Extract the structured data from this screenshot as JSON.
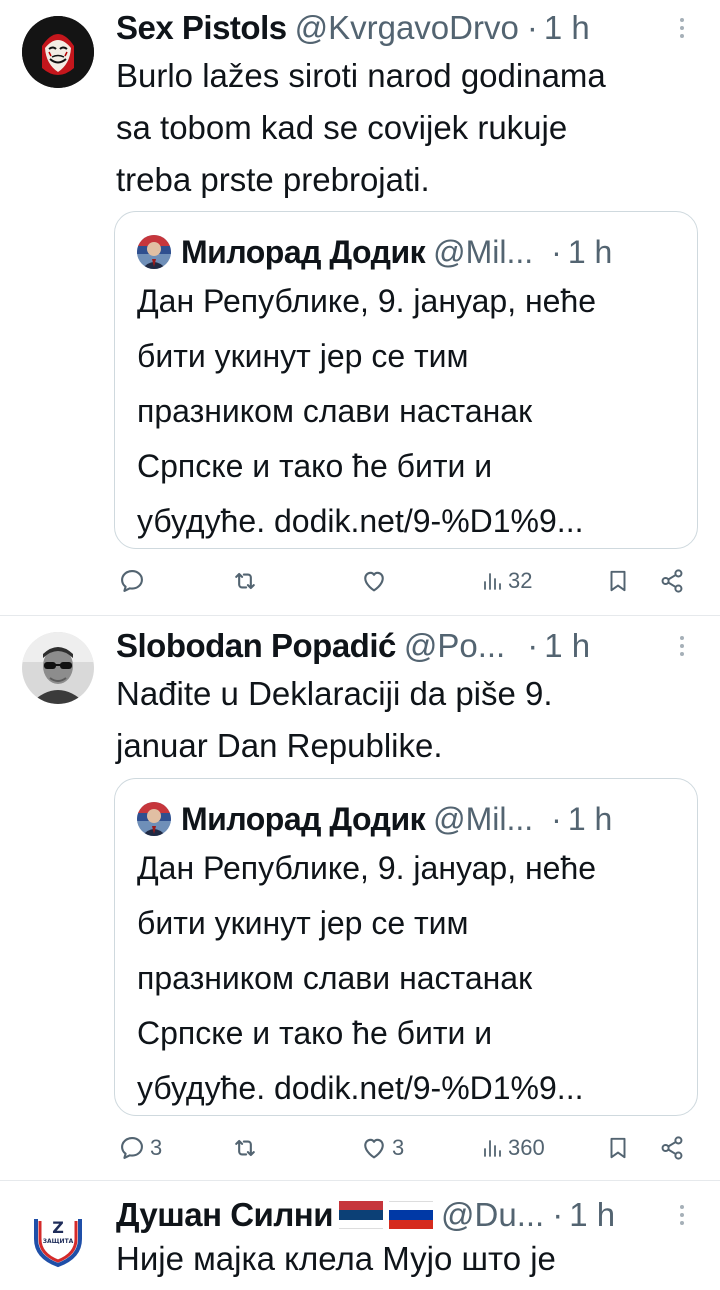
{
  "tweets": [
    {
      "name": "Sex Pistols",
      "handle": "@KvrgavoDrvo",
      "dot": "·",
      "time": "1 h",
      "text_lines": [
        "Burlo lažes siroti narod godinama",
        "sa tobom kad se covijek rukuje",
        "treba prste prebrojati."
      ],
      "quote": {
        "name": "Милорад Додик",
        "handle": "@Mil...",
        "dot": "·",
        "time": "1 h",
        "lines": [
          "Дан Републике, 9. јануар, неће",
          "бити укинут јер се тим",
          "празником слави настанак",
          "Српске и тако ће бити и",
          "убудуће. dodik.net/9-%D1%9..."
        ]
      },
      "stats": {
        "replies": "",
        "reposts": "",
        "likes": "",
        "views": "32"
      }
    },
    {
      "name": "Slobodan Popadić",
      "handle": "@Po...",
      "dot": "·",
      "time": "1 h",
      "text_lines": [
        "Nađite u Deklaraciji da piše 9.",
        "januar Dan Republike."
      ],
      "quote": {
        "name": "Милорад Додик",
        "handle": "@Mil...",
        "dot": "·",
        "time": "1 h",
        "lines": [
          "Дан Републике, 9. јануар, неће",
          "бити укинут јер се тим",
          "празником слави настанак",
          "Српске и тако ће бити и",
          "убудуће. dodik.net/9-%D1%9..."
        ]
      },
      "stats": {
        "replies": "3",
        "reposts": "",
        "likes": "3",
        "views": "360"
      }
    },
    {
      "name": "Душан Силни",
      "handle": "@Du...",
      "dot": "·",
      "time": "1 h",
      "text_lines": [
        "Није мајка клела Мујо што је"
      ]
    }
  ],
  "avatar3_text": "ЗАЩИТА",
  "icons": [
    "reply-icon",
    "repost-icon",
    "like-icon",
    "views-icon",
    "bookmark-icon",
    "share-icon",
    "more-icon"
  ],
  "colors": {
    "text": "#0f1419",
    "secondary": "#536471",
    "border": "#cfd9de",
    "divider": "#e6e9ec"
  }
}
